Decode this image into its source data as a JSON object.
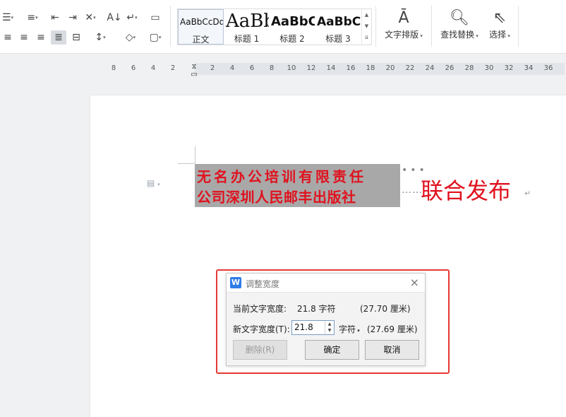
{
  "ribbon": {
    "styles": [
      {
        "sample": "AaBbCcDd",
        "label": "正文"
      },
      {
        "sample": "AaBb",
        "label": "标题 1"
      },
      {
        "sample": "AaBbC",
        "label": "标题 2"
      },
      {
        "sample": "AaBbCc",
        "label": "标题 3"
      }
    ],
    "text_layout_label": "文字排版",
    "find_replace_label": "查找替换",
    "select_label": "选择"
  },
  "ruler": {
    "ticks": [
      "8",
      "6",
      "4",
      "2",
      "2",
      "4",
      "6",
      "8",
      "10",
      "12",
      "14",
      "16",
      "18",
      "20",
      "22",
      "24",
      "26",
      "28",
      "30",
      "32",
      "34",
      "36"
    ]
  },
  "document": {
    "line1": "无名办公培训有限责任",
    "line2": "公司深圳人民邮丰出版社",
    "dots1": "•••",
    "dots2": "……",
    "joint_text": "联合发布",
    "paragraph_mark": "↵"
  },
  "dialog": {
    "title": "调整宽度",
    "current_width_label": "当前文字宽度:",
    "current_width_value": "21.8 字符",
    "current_width_cm": "(27.70 厘米)",
    "new_width_label": "新文字宽度(T):",
    "new_width_value": "21.8",
    "unit": "字符",
    "new_width_cm": "(27.69 厘米)",
    "delete_button": "删除(R)",
    "ok_button": "确定",
    "cancel_button": "取消"
  }
}
